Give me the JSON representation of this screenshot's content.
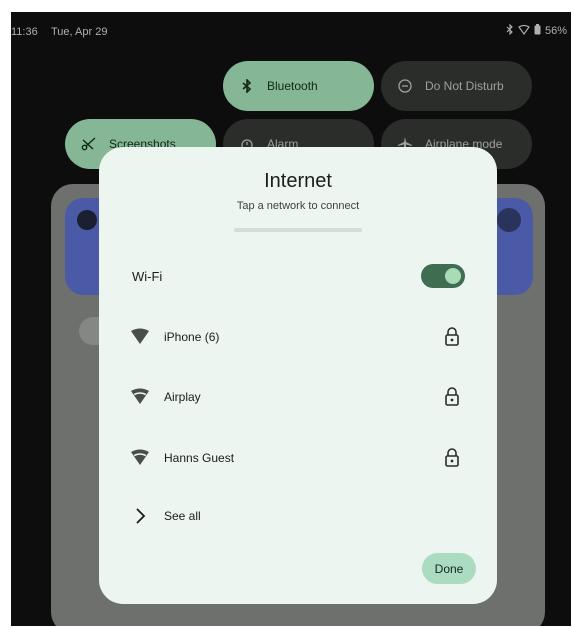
{
  "status_bar": {
    "time": "11:36",
    "date": "Tue, Apr 29",
    "battery": "56%",
    "icons": [
      "bluetooth-icon",
      "wifi-outline-icon",
      "battery-icon"
    ]
  },
  "quick_tiles": {
    "bluetooth": {
      "label": "Bluetooth",
      "active": true
    },
    "do_not_disturb": {
      "label": "Do Not Disturb",
      "active": false
    },
    "screenshots": {
      "label": "Screenshots",
      "active": true
    },
    "alarm": {
      "label": "Alarm",
      "active": false
    },
    "airplane_mode": {
      "label": "Airplane mode",
      "active": false
    }
  },
  "internet_dialog": {
    "title": "Internet",
    "subtitle": "Tap a network to connect",
    "wifi": {
      "label": "Wi-Fi",
      "enabled": true
    },
    "networks": [
      {
        "name": "iPhone (6)",
        "secured": true,
        "signal": "full"
      },
      {
        "name": "Airplay",
        "secured": true,
        "signal": "partial"
      },
      {
        "name": "Hanns Guest",
        "secured": true,
        "signal": "partial"
      }
    ],
    "see_all": "See all",
    "done": "Done"
  },
  "colors": {
    "dialog_bg": "#ecf5ef",
    "toggle_on": "#3f6d52",
    "done_button": "#abdcc2",
    "tile_active": "#85b696",
    "tile_inactive": "#2b2d2b"
  }
}
